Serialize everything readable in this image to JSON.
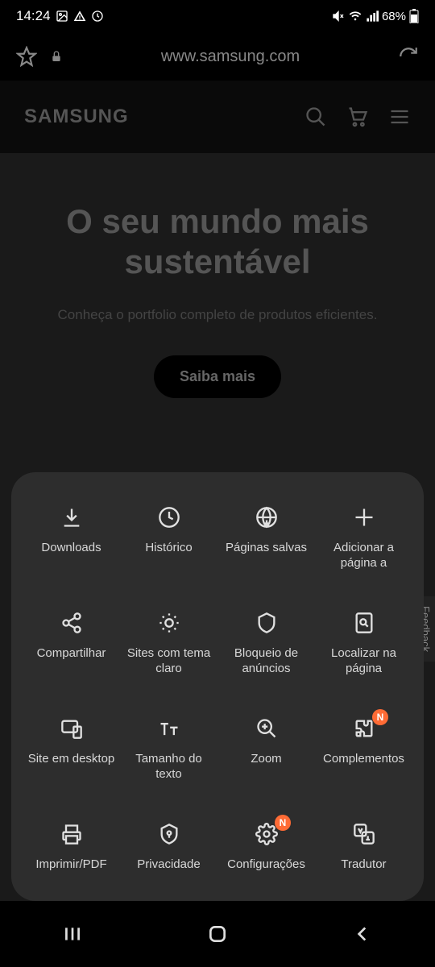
{
  "status": {
    "time": "14:24",
    "battery": "68%"
  },
  "browser": {
    "url": "www.samsung.com"
  },
  "page": {
    "logo": "SAMSUNG",
    "hero_title": "O seu mundo mais sustentável",
    "hero_subtitle": "Conheça o portfolio completo de produtos eficientes.",
    "cta": "Saiba mais",
    "feedback": "Feedback"
  },
  "menu": [
    {
      "label": "Downloads"
    },
    {
      "label": "Histórico"
    },
    {
      "label": "Páginas salvas"
    },
    {
      "label": "Adicionar a página a"
    },
    {
      "label": "Compartilhar"
    },
    {
      "label": "Sites com tema claro"
    },
    {
      "label": "Bloqueio de anúncios"
    },
    {
      "label": "Localizar na página"
    },
    {
      "label": "Site em desktop"
    },
    {
      "label": "Tamanho do texto"
    },
    {
      "label": "Zoom"
    },
    {
      "label": "Complementos",
      "badge": "N"
    },
    {
      "label": "Imprimir/PDF"
    },
    {
      "label": "Privacidade"
    },
    {
      "label": "Configurações",
      "badge": "N"
    },
    {
      "label": "Tradutor"
    }
  ]
}
